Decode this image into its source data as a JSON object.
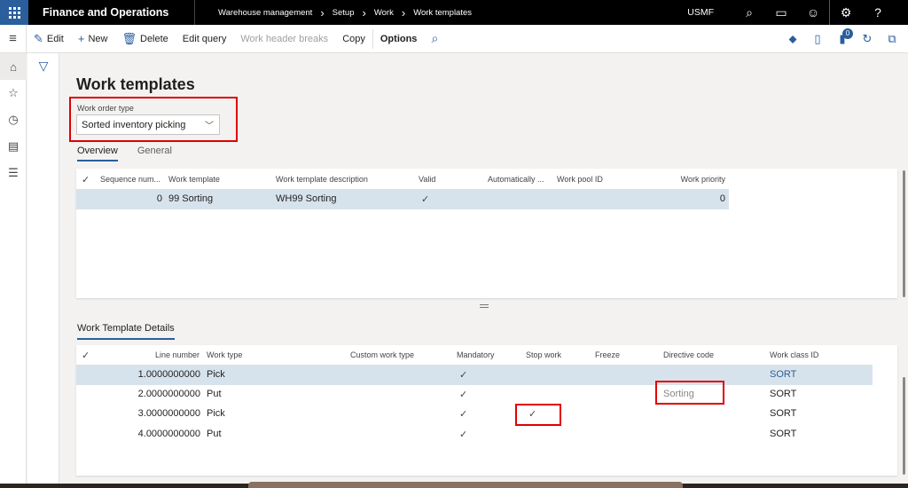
{
  "topbar": {
    "app_title": "Finance and Operations",
    "breadcrumb": [
      "Warehouse management",
      "Setup",
      "Work",
      "Work templates"
    ],
    "company": "USMF",
    "icons": [
      "search-icon",
      "chat-icon",
      "smiley-icon",
      "gear-icon",
      "help-icon"
    ]
  },
  "actionbar": {
    "edit": "Edit",
    "new": "New",
    "delete": "Delete",
    "edit_query": "Edit query",
    "work_header_breaks": "Work header breaks",
    "copy": "Copy",
    "options": "Options",
    "notifications_count": "0"
  },
  "page": {
    "title": "Work templates",
    "work_order_type_label": "Work order type",
    "work_order_type_value": "Sorted inventory picking",
    "tabs": [
      {
        "label": "Overview",
        "active": true
      },
      {
        "label": "General",
        "active": false
      }
    ]
  },
  "templates_grid": {
    "columns": [
      "Sequence num...",
      "Work template",
      "Work template description",
      "Valid",
      "Automatically ...",
      "Work pool ID",
      "Work priority"
    ],
    "rows": [
      {
        "sequence": "0",
        "work_template": "99 Sorting",
        "description": "WH99 Sorting",
        "valid": "✓",
        "auto": "",
        "work_pool_id": "",
        "priority": "0",
        "selected": true
      }
    ]
  },
  "details": {
    "section_title": "Work Template Details",
    "columns": [
      "Line number",
      "Work type",
      "Custom work type",
      "Mandatory",
      "Stop work",
      "Freeze",
      "Directive code",
      "Work class ID"
    ],
    "rows": [
      {
        "line": "1.0000000000",
        "work_type": "Pick",
        "custom": "",
        "mandatory": "✓",
        "stop_work": "",
        "freeze": "",
        "directive": "",
        "work_class": "SORT",
        "selected": true
      },
      {
        "line": "2.0000000000",
        "work_type": "Put",
        "custom": "",
        "mandatory": "✓",
        "stop_work": "",
        "freeze": "",
        "directive": "Sorting",
        "work_class": "SORT",
        "selected": false
      },
      {
        "line": "3.0000000000",
        "work_type": "Pick",
        "custom": "",
        "mandatory": "✓",
        "stop_work": "✓",
        "freeze": "",
        "directive": "",
        "work_class": "SORT",
        "selected": false
      },
      {
        "line": "4.0000000000",
        "work_type": "Put",
        "custom": "",
        "mandatory": "✓",
        "stop_work": "",
        "freeze": "",
        "directive": "",
        "work_class": "SORT",
        "selected": false
      }
    ]
  },
  "select_all_glyph": "✓"
}
